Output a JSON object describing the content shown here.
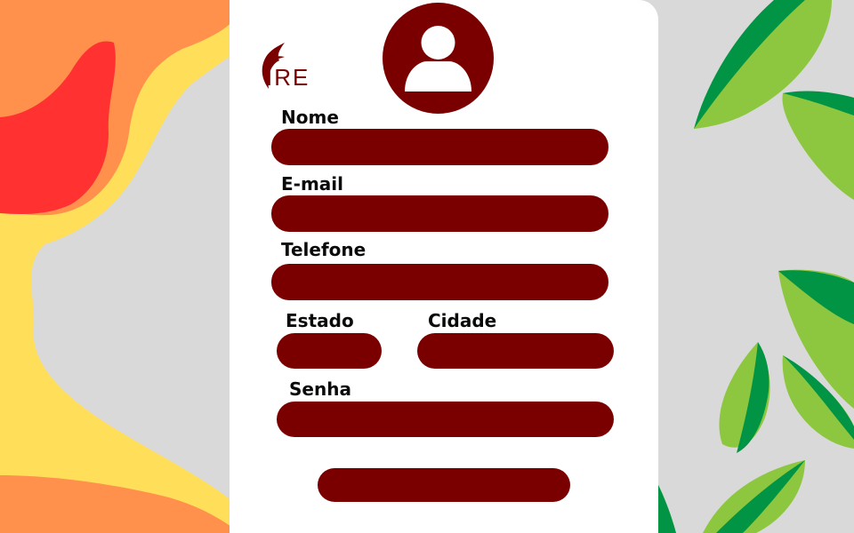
{
  "brand": {
    "logo_text": "IRE",
    "logo_icon": "flame-icon"
  },
  "avatar": {
    "icon": "user-icon"
  },
  "form": {
    "nome_label": "Nome",
    "email_label": "E-mail",
    "telefone_label": "Telefone",
    "estado_label": "Estado",
    "cidade_label": "Cidade",
    "senha_label": "Senha",
    "nome_value": "",
    "email_value": "",
    "telefone_value": "",
    "estado_value": "",
    "cidade_value": "",
    "senha_value": "",
    "submit_label": ""
  },
  "colors": {
    "accent": "#7a0000",
    "background": "#d9d9d9",
    "card": "#ffffff",
    "flame_orange": "#ff914d",
    "flame_red": "#ff3131",
    "flame_yellow": "#ffde59",
    "leaf_light": "#8dc63f",
    "leaf_dark": "#009444"
  }
}
